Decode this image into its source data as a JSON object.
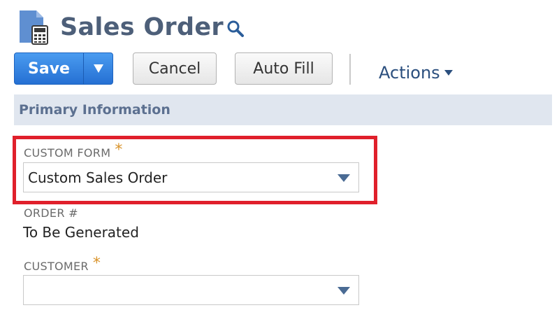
{
  "header": {
    "title": "Sales Order",
    "page_icon": "document-calculator-icon",
    "search_icon": "search-icon"
  },
  "toolbar": {
    "save_label": "Save",
    "save_menu_icon": "caret-down-icon",
    "cancel_label": "Cancel",
    "autofill_label": "Auto Fill",
    "actions_label": "Actions",
    "actions_icon": "caret-down-icon"
  },
  "section": {
    "title": "Primary Information"
  },
  "fields": {
    "custom_form": {
      "label": "CUSTOM FORM",
      "required_mark": "*",
      "value": "Custom Sales Order"
    },
    "order_number": {
      "label": "ORDER #",
      "value": "To Be Generated"
    },
    "customer": {
      "label": "CUSTOMER",
      "required_mark": "*",
      "value": ""
    }
  },
  "colors": {
    "title": "#4d5f79",
    "primary_button": "#2b7de0",
    "section_bar": "#e0e6ef",
    "required": "#d9932a",
    "highlight": "#e0202b",
    "link": "#2b4f7e"
  }
}
